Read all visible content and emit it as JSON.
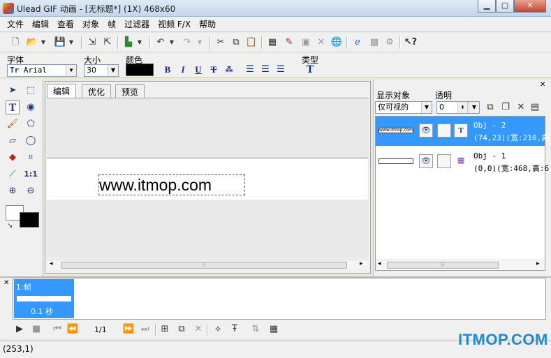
{
  "window": {
    "title": "Ulead GIF 动画 - [无标题*] (1X) 468x60",
    "minimize_glyph": "▁",
    "maximize_glyph": "▢",
    "close_glyph": "✕"
  },
  "menu": [
    "文件",
    "编辑",
    "查看",
    "对象",
    "帧",
    "过滤器",
    "视频 F/X",
    "帮助"
  ],
  "toolbar": {
    "icons": [
      "new-icon",
      "open-icon",
      "save-icon",
      "import-icon",
      "export-icon",
      "color-fill-icon",
      "undo-icon",
      "redo-icon",
      "cut-icon",
      "copy-icon",
      "paste-icon",
      "frame-properties-icon",
      "edit-icon",
      "preview-icon",
      "delete-icon",
      "browser-icon",
      "ie-preview-icon",
      "optimize-icon",
      "tools-icon",
      "help-icon"
    ]
  },
  "textbar": {
    "font_label": "字体",
    "font_value": "Arial",
    "size_label": "大小",
    "size_value": "30",
    "color_label": "颜色",
    "color_value": "#000000",
    "type_label": "类型",
    "bold": "B",
    "italic": "I",
    "underline": "U",
    "strike": "T",
    "type_glyph": "T"
  },
  "editor": {
    "tabs": [
      "编辑",
      "优化",
      "预览"
    ],
    "canvas_text": "www.itmop.com"
  },
  "objects_panel": {
    "display_label": "显示对象",
    "display_value": "仅可视的",
    "opacity_label": "透明",
    "opacity_value": "0",
    "objects": [
      {
        "name": "Obj - 2",
        "info": "(74,23)(宽:210,高",
        "type_glyph": "T",
        "preview": "www.itmop.com"
      },
      {
        "name": "Obj - 1",
        "info": "(0,0)(宽:468,高:6",
        "type_glyph": "▦",
        "preview": ""
      }
    ]
  },
  "frames": {
    "frame1_label": "1:帧",
    "frame1_delay": "0.1 秒",
    "counter": "1/1"
  },
  "status": {
    "coords": "(253,1)"
  },
  "watermark": "ITMOP.COM",
  "colors": {
    "selection": "#3399ff",
    "watermark": "#1f8ad8"
  }
}
